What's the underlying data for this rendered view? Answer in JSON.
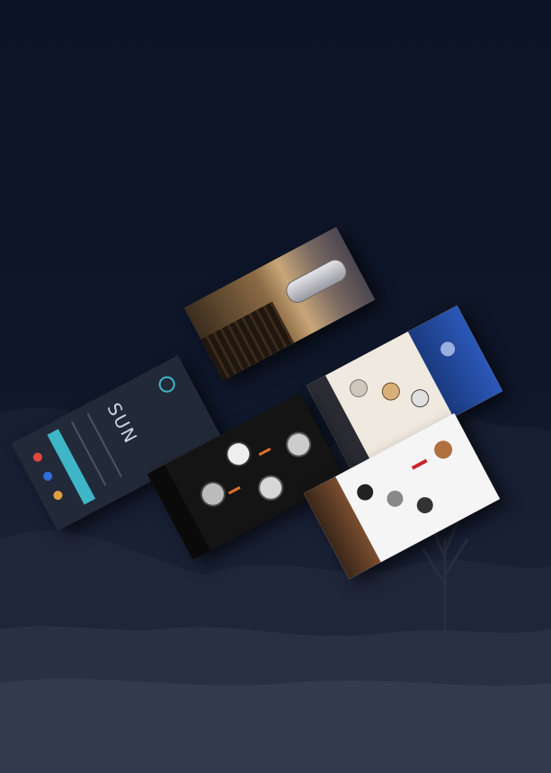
{
  "login": {
    "logo_text": "SUN",
    "field_1": "",
    "field_2": "",
    "button_label": ""
  },
  "colors": {
    "background": "#0e1629",
    "accent_teal": "#3fb6c8",
    "login_panel": "#222938",
    "social_1": "#e0483e",
    "social_2": "#2f6fd8",
    "social_3": "#e0a040",
    "banner_blue": "#1d3f8f",
    "brand_red": "#c8232c"
  },
  "screens": [
    {
      "name": "login-screen"
    },
    {
      "name": "hero-city-screen"
    },
    {
      "name": "watch-catalog-blue-screen"
    },
    {
      "name": "watch-catalog-dark-screen"
    },
    {
      "name": "watch-catalog-white-screen"
    }
  ]
}
